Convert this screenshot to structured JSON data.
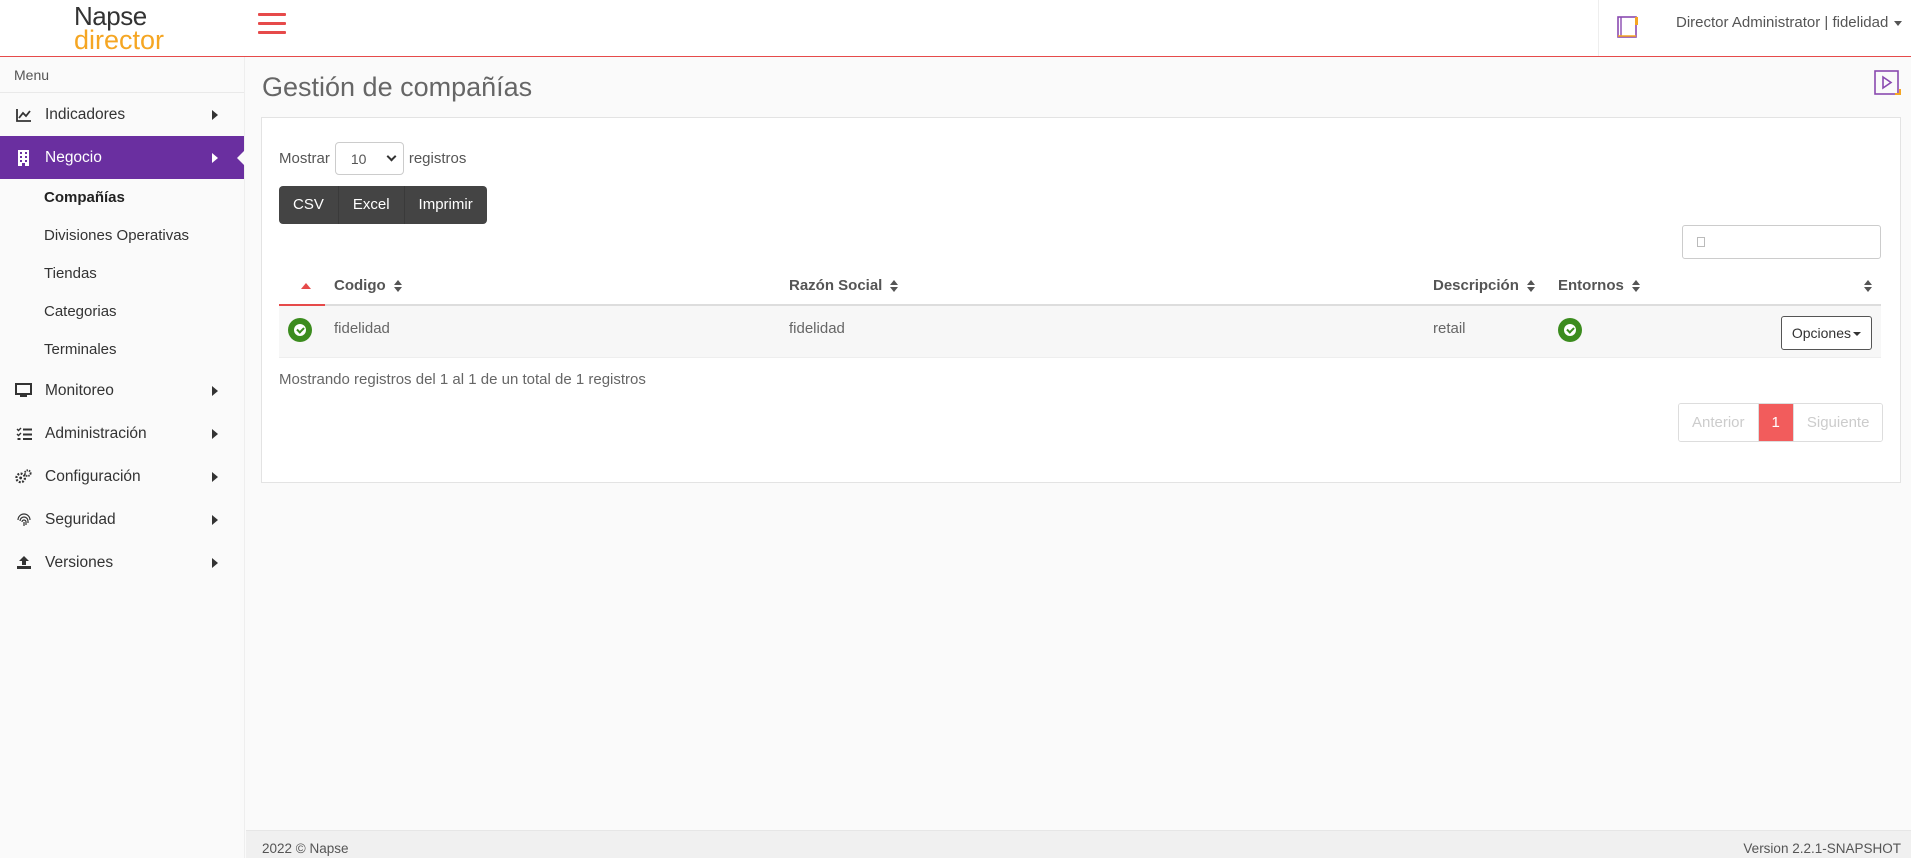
{
  "header": {
    "logo_line1": "Napse",
    "logo_line2": "director",
    "user_menu": "Director Administrator | fidelidad",
    "icons": {
      "menu": "hamburger-icon",
      "book": "book-icon"
    }
  },
  "sidebar": {
    "menu_label": "Menu",
    "items": [
      {
        "label": "Indicadores",
        "icon": "line-chart-icon"
      },
      {
        "label": "Negocio",
        "icon": "building-icon",
        "active": true
      },
      {
        "label": "Monitoreo",
        "icon": "monitor-icon"
      },
      {
        "label": "Administración",
        "icon": "tasks-list-icon"
      },
      {
        "label": "Configuración",
        "icon": "gears-icon"
      },
      {
        "label": "Seguridad",
        "icon": "fingerprint-icon"
      },
      {
        "label": "Versiones",
        "icon": "upload-icon"
      }
    ],
    "subitems": [
      {
        "label": "Compañías",
        "active": true
      },
      {
        "label": "Divisiones Operativas"
      },
      {
        "label": "Tiendas"
      },
      {
        "label": "Categorias"
      },
      {
        "label": "Terminales"
      }
    ]
  },
  "main": {
    "title": "Gestión de compañías",
    "show_label": "Mostrar",
    "page_size": "10",
    "records_label": "registros",
    "export_buttons": [
      "CSV",
      "Excel",
      "Imprimir"
    ],
    "table": {
      "columns": [
        "Codigo",
        "Razón Social",
        "Descripción",
        "Entornos"
      ],
      "rows": [
        {
          "codigo": "fidelidad",
          "razon_social": "fidelidad",
          "descripcion": "retail",
          "options_label": "Opciones"
        }
      ]
    },
    "info": "Mostrando registros del 1 al 1 de un total de 1 registros",
    "pagination": {
      "prev": "Anterior",
      "current": "1",
      "next": "Siguiente"
    }
  },
  "footer": {
    "copyright": "2022 © Napse",
    "version": "Version 2.2.1-SNAPSHOT"
  },
  "colors": {
    "accent_red": "#e64a4a",
    "active_purple": "#6a2fa0",
    "status_green": "#3c8c1e",
    "logo_orange": "#f5a623"
  }
}
